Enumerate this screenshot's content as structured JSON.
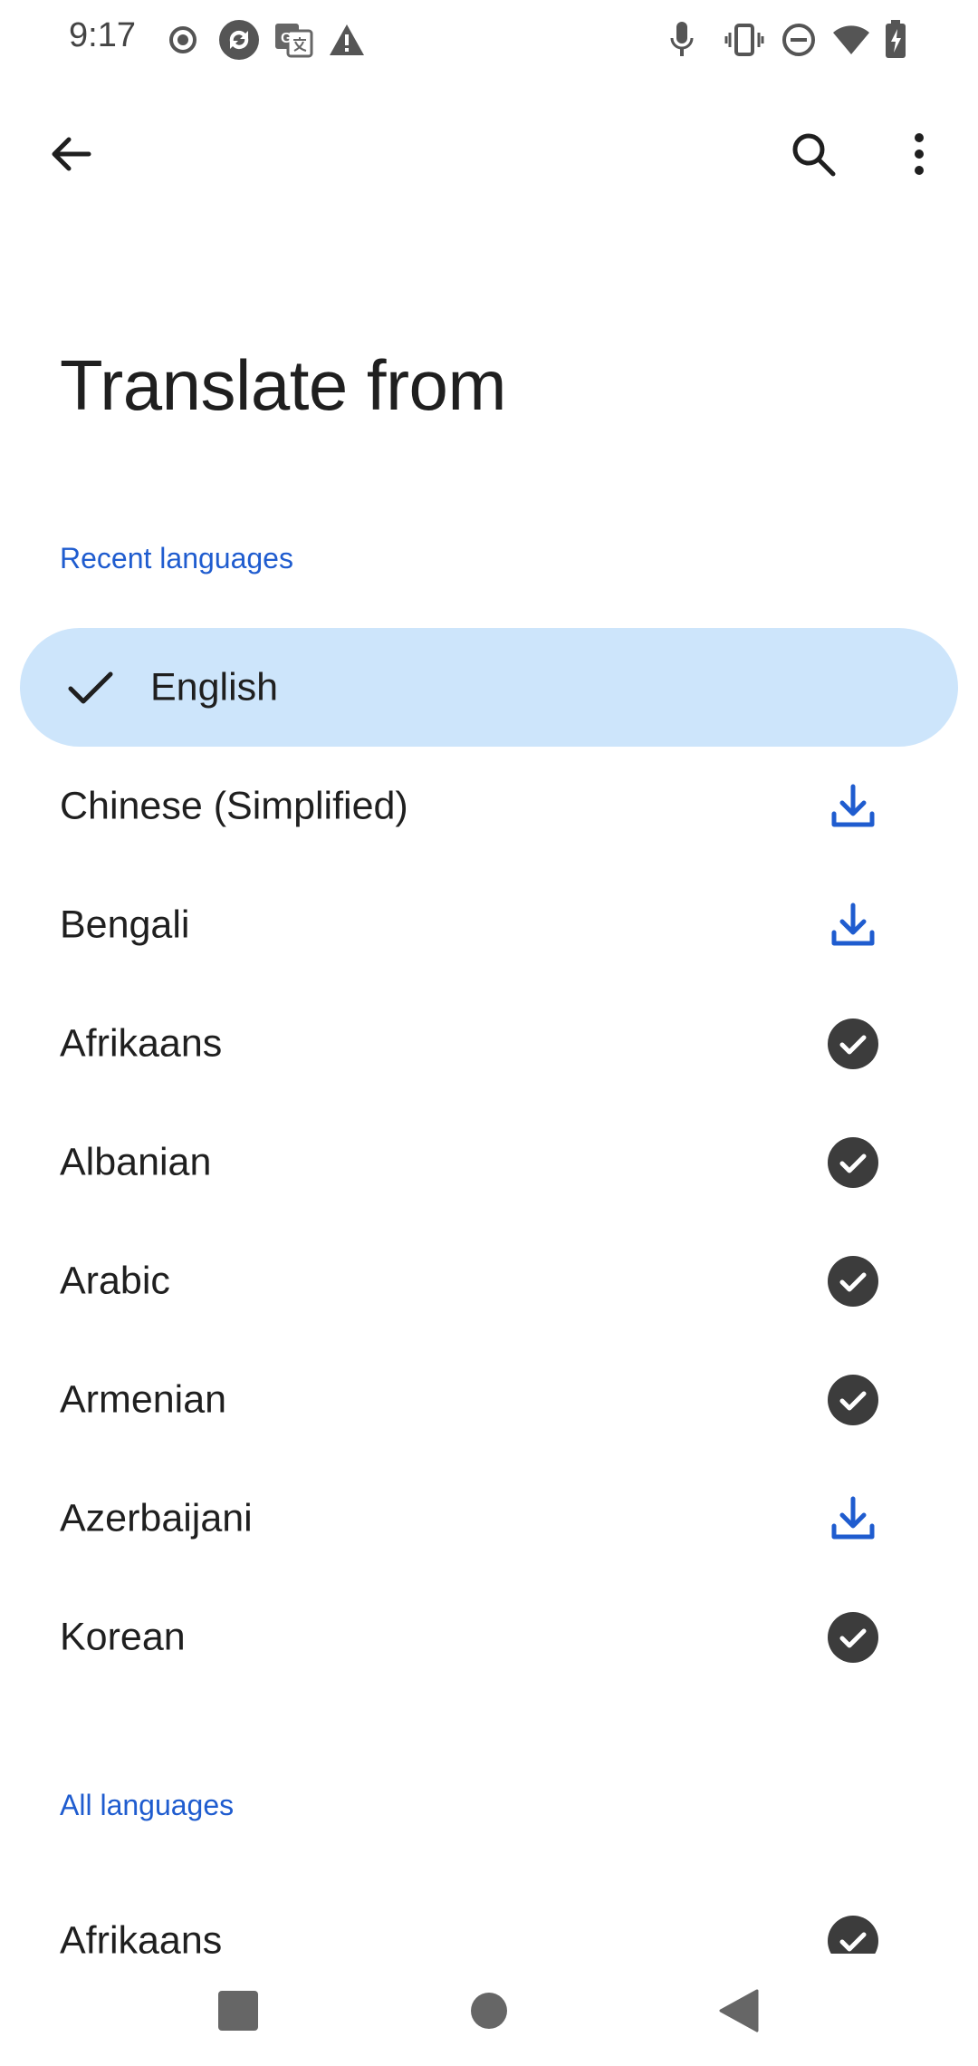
{
  "status_bar": {
    "time": "9:17",
    "left_icons": [
      "record-icon",
      "sync-app-icon",
      "translate-app-icon",
      "warning-icon"
    ],
    "right_icons": [
      "mic-icon",
      "vibrate-icon",
      "do-not-disturb-icon",
      "wifi-icon",
      "battery-charging-icon"
    ]
  },
  "app_bar": {
    "back_icon": "arrow-back-icon",
    "search_icon": "search-icon",
    "more_icon": "more-vert-icon"
  },
  "page": {
    "title": "Translate from"
  },
  "recent_section": {
    "label": "Recent languages",
    "items": [
      {
        "name": "English",
        "selected": true,
        "status": "selected"
      },
      {
        "name": "Chinese (Simplified)",
        "status": "download"
      },
      {
        "name": "Bengali",
        "status": "download"
      },
      {
        "name": "Afrikaans",
        "status": "downloaded"
      },
      {
        "name": "Albanian",
        "status": "downloaded"
      },
      {
        "name": "Arabic",
        "status": "downloaded"
      },
      {
        "name": "Armenian",
        "status": "downloaded"
      },
      {
        "name": "Azerbaijani",
        "status": "download"
      },
      {
        "name": "Korean",
        "status": "downloaded"
      }
    ]
  },
  "all_section": {
    "label": "All languages",
    "items": [
      {
        "name": "Afrikaans",
        "status": "downloaded"
      }
    ]
  },
  "nav_bar": {
    "icons": [
      "recents-square-icon",
      "home-circle-icon",
      "back-triangle-icon"
    ]
  },
  "colors": {
    "accent": "#1f5ccf",
    "selected_background": "#cde5fb",
    "downloaded_badge": "#3c3c3c",
    "text_primary": "#1f1f1f"
  }
}
